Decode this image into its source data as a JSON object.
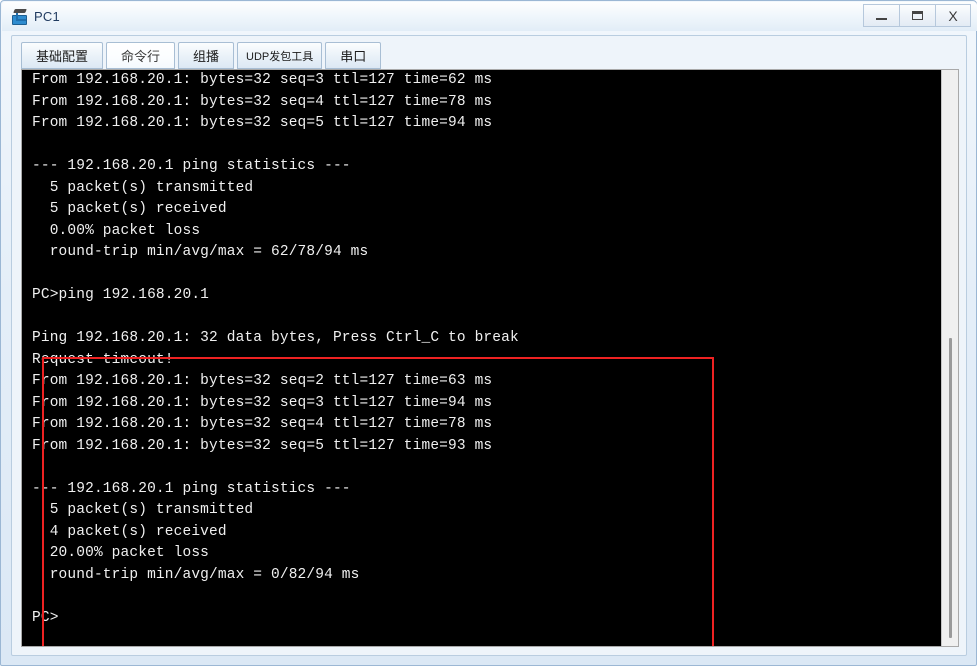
{
  "window": {
    "title": "PC1",
    "icon": "pc-device-icon",
    "controls": {
      "minimize_label": "—",
      "maximize_label": "□",
      "close_label": "X"
    }
  },
  "tabs": [
    {
      "id": "tab-basic-config",
      "label": "基础配置",
      "active": false
    },
    {
      "id": "tab-command-line",
      "label": "命令行",
      "active": true
    },
    {
      "id": "tab-multicast",
      "label": "组播",
      "active": false
    },
    {
      "id": "tab-udp-tool",
      "label": "UDP发包工具",
      "active": false
    },
    {
      "id": "tab-serial-port",
      "label": "串口",
      "active": false
    }
  ],
  "terminal": {
    "prompt": "PC>",
    "lines": [
      "From 192.168.20.1: bytes=32 seq=3 ttl=127 time=62 ms",
      "From 192.168.20.1: bytes=32 seq=4 ttl=127 time=78 ms",
      "From 192.168.20.1: bytes=32 seq=5 ttl=127 time=94 ms",
      "",
      "--- 192.168.20.1 ping statistics ---",
      "  5 packet(s) transmitted",
      "  5 packet(s) received",
      "  0.00% packet loss",
      "  round-trip min/avg/max = 62/78/94 ms",
      "",
      "PC>ping 192.168.20.1",
      "",
      "Ping 192.168.20.1: 32 data bytes, Press Ctrl_C to break",
      "Request timeout!",
      "From 192.168.20.1: bytes=32 seq=2 ttl=127 time=63 ms",
      "From 192.168.20.1: bytes=32 seq=3 ttl=127 time=94 ms",
      "From 192.168.20.1: bytes=32 seq=4 ttl=127 time=78 ms",
      "From 192.168.20.1: bytes=32 seq=5 ttl=127 time=93 ms",
      "",
      "--- 192.168.20.1 ping statistics ---",
      "  5 packet(s) transmitted",
      "  4 packet(s) received",
      "  20.00% packet loss",
      "  round-trip min/avg/max = 0/82/94 ms",
      "",
      "PC>"
    ]
  },
  "annotation": {
    "highlight_color": "#ee2222",
    "description": "red-rectangle-highlight"
  },
  "colors": {
    "terminal_background": "#000000",
    "terminal_text": "#f0f0f0",
    "window_chrome": "#dbe8f5",
    "accent": "#2e8ccf"
  }
}
